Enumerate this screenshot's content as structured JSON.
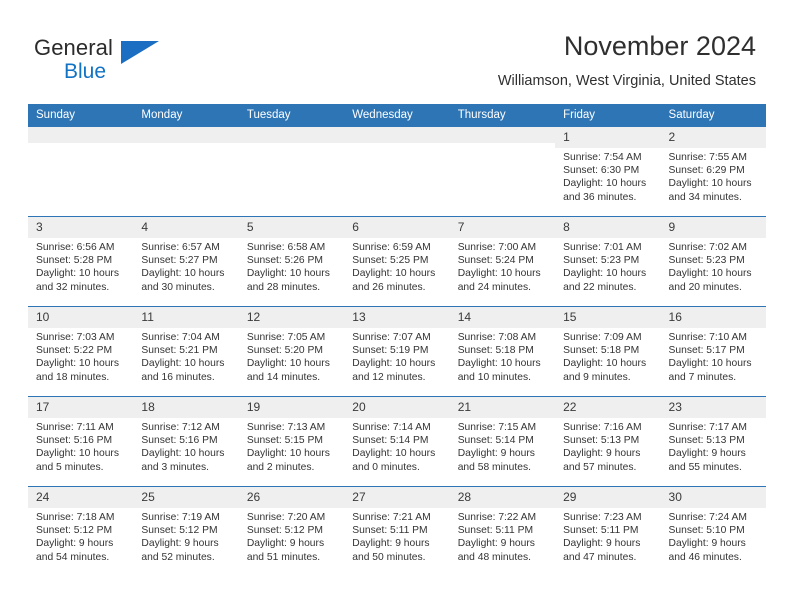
{
  "brand": {
    "name_top": "General",
    "name_bottom": "Blue",
    "triangle_color": "#1b6ec2",
    "text_color": "#2b2b2b",
    "accent_color": "#1273c4"
  },
  "header": {
    "title": "November 2024",
    "subtitle": "Williamson, West Virginia, United States"
  },
  "theme": {
    "header_bg": "#2e75b6",
    "header_text": "#ffffff",
    "daynum_bg": "#efefef",
    "cell_bg": "#ffffff",
    "row_border": "#2e75b6"
  },
  "weekdays": [
    "Sunday",
    "Monday",
    "Tuesday",
    "Wednesday",
    "Thursday",
    "Friday",
    "Saturday"
  ],
  "weeks": [
    [
      {
        "day": "",
        "empty": true
      },
      {
        "day": "",
        "empty": true
      },
      {
        "day": "",
        "empty": true
      },
      {
        "day": "",
        "empty": true
      },
      {
        "day": "",
        "empty": true
      },
      {
        "day": "1",
        "sunrise": "Sunrise: 7:54 AM",
        "sunset": "Sunset: 6:30 PM",
        "daylight_1": "Daylight: 10 hours",
        "daylight_2": "and 36 minutes."
      },
      {
        "day": "2",
        "sunrise": "Sunrise: 7:55 AM",
        "sunset": "Sunset: 6:29 PM",
        "daylight_1": "Daylight: 10 hours",
        "daylight_2": "and 34 minutes."
      }
    ],
    [
      {
        "day": "3",
        "sunrise": "Sunrise: 6:56 AM",
        "sunset": "Sunset: 5:28 PM",
        "daylight_1": "Daylight: 10 hours",
        "daylight_2": "and 32 minutes."
      },
      {
        "day": "4",
        "sunrise": "Sunrise: 6:57 AM",
        "sunset": "Sunset: 5:27 PM",
        "daylight_1": "Daylight: 10 hours",
        "daylight_2": "and 30 minutes."
      },
      {
        "day": "5",
        "sunrise": "Sunrise: 6:58 AM",
        "sunset": "Sunset: 5:26 PM",
        "daylight_1": "Daylight: 10 hours",
        "daylight_2": "and 28 minutes."
      },
      {
        "day": "6",
        "sunrise": "Sunrise: 6:59 AM",
        "sunset": "Sunset: 5:25 PM",
        "daylight_1": "Daylight: 10 hours",
        "daylight_2": "and 26 minutes."
      },
      {
        "day": "7",
        "sunrise": "Sunrise: 7:00 AM",
        "sunset": "Sunset: 5:24 PM",
        "daylight_1": "Daylight: 10 hours",
        "daylight_2": "and 24 minutes."
      },
      {
        "day": "8",
        "sunrise": "Sunrise: 7:01 AM",
        "sunset": "Sunset: 5:23 PM",
        "daylight_1": "Daylight: 10 hours",
        "daylight_2": "and 22 minutes."
      },
      {
        "day": "9",
        "sunrise": "Sunrise: 7:02 AM",
        "sunset": "Sunset: 5:23 PM",
        "daylight_1": "Daylight: 10 hours",
        "daylight_2": "and 20 minutes."
      }
    ],
    [
      {
        "day": "10",
        "sunrise": "Sunrise: 7:03 AM",
        "sunset": "Sunset: 5:22 PM",
        "daylight_1": "Daylight: 10 hours",
        "daylight_2": "and 18 minutes."
      },
      {
        "day": "11",
        "sunrise": "Sunrise: 7:04 AM",
        "sunset": "Sunset: 5:21 PM",
        "daylight_1": "Daylight: 10 hours",
        "daylight_2": "and 16 minutes."
      },
      {
        "day": "12",
        "sunrise": "Sunrise: 7:05 AM",
        "sunset": "Sunset: 5:20 PM",
        "daylight_1": "Daylight: 10 hours",
        "daylight_2": "and 14 minutes."
      },
      {
        "day": "13",
        "sunrise": "Sunrise: 7:07 AM",
        "sunset": "Sunset: 5:19 PM",
        "daylight_1": "Daylight: 10 hours",
        "daylight_2": "and 12 minutes."
      },
      {
        "day": "14",
        "sunrise": "Sunrise: 7:08 AM",
        "sunset": "Sunset: 5:18 PM",
        "daylight_1": "Daylight: 10 hours",
        "daylight_2": "and 10 minutes."
      },
      {
        "day": "15",
        "sunrise": "Sunrise: 7:09 AM",
        "sunset": "Sunset: 5:18 PM",
        "daylight_1": "Daylight: 10 hours",
        "daylight_2": "and 9 minutes."
      },
      {
        "day": "16",
        "sunrise": "Sunrise: 7:10 AM",
        "sunset": "Sunset: 5:17 PM",
        "daylight_1": "Daylight: 10 hours",
        "daylight_2": "and 7 minutes."
      }
    ],
    [
      {
        "day": "17",
        "sunrise": "Sunrise: 7:11 AM",
        "sunset": "Sunset: 5:16 PM",
        "daylight_1": "Daylight: 10 hours",
        "daylight_2": "and 5 minutes."
      },
      {
        "day": "18",
        "sunrise": "Sunrise: 7:12 AM",
        "sunset": "Sunset: 5:16 PM",
        "daylight_1": "Daylight: 10 hours",
        "daylight_2": "and 3 minutes."
      },
      {
        "day": "19",
        "sunrise": "Sunrise: 7:13 AM",
        "sunset": "Sunset: 5:15 PM",
        "daylight_1": "Daylight: 10 hours",
        "daylight_2": "and 2 minutes."
      },
      {
        "day": "20",
        "sunrise": "Sunrise: 7:14 AM",
        "sunset": "Sunset: 5:14 PM",
        "daylight_1": "Daylight: 10 hours",
        "daylight_2": "and 0 minutes."
      },
      {
        "day": "21",
        "sunrise": "Sunrise: 7:15 AM",
        "sunset": "Sunset: 5:14 PM",
        "daylight_1": "Daylight: 9 hours",
        "daylight_2": "and 58 minutes."
      },
      {
        "day": "22",
        "sunrise": "Sunrise: 7:16 AM",
        "sunset": "Sunset: 5:13 PM",
        "daylight_1": "Daylight: 9 hours",
        "daylight_2": "and 57 minutes."
      },
      {
        "day": "23",
        "sunrise": "Sunrise: 7:17 AM",
        "sunset": "Sunset: 5:13 PM",
        "daylight_1": "Daylight: 9 hours",
        "daylight_2": "and 55 minutes."
      }
    ],
    [
      {
        "day": "24",
        "sunrise": "Sunrise: 7:18 AM",
        "sunset": "Sunset: 5:12 PM",
        "daylight_1": "Daylight: 9 hours",
        "daylight_2": "and 54 minutes."
      },
      {
        "day": "25",
        "sunrise": "Sunrise: 7:19 AM",
        "sunset": "Sunset: 5:12 PM",
        "daylight_1": "Daylight: 9 hours",
        "daylight_2": "and 52 minutes."
      },
      {
        "day": "26",
        "sunrise": "Sunrise: 7:20 AM",
        "sunset": "Sunset: 5:12 PM",
        "daylight_1": "Daylight: 9 hours",
        "daylight_2": "and 51 minutes."
      },
      {
        "day": "27",
        "sunrise": "Sunrise: 7:21 AM",
        "sunset": "Sunset: 5:11 PM",
        "daylight_1": "Daylight: 9 hours",
        "daylight_2": "and 50 minutes."
      },
      {
        "day": "28",
        "sunrise": "Sunrise: 7:22 AM",
        "sunset": "Sunset: 5:11 PM",
        "daylight_1": "Daylight: 9 hours",
        "daylight_2": "and 48 minutes."
      },
      {
        "day": "29",
        "sunrise": "Sunrise: 7:23 AM",
        "sunset": "Sunset: 5:11 PM",
        "daylight_1": "Daylight: 9 hours",
        "daylight_2": "and 47 minutes."
      },
      {
        "day": "30",
        "sunrise": "Sunrise: 7:24 AM",
        "sunset": "Sunset: 5:10 PM",
        "daylight_1": "Daylight: 9 hours",
        "daylight_2": "and 46 minutes."
      }
    ]
  ]
}
